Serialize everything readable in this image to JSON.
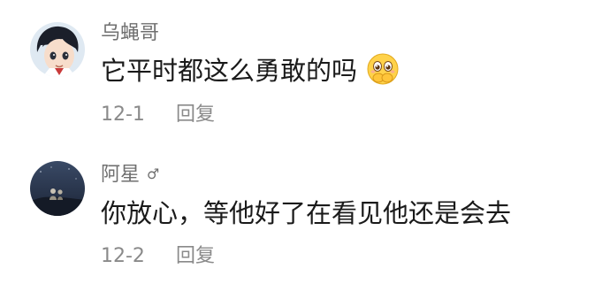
{
  "comments": [
    {
      "username": "乌蝇哥",
      "gender_mark": "",
      "text": "它平时都这么勇敢的吗",
      "emoji": "pleading-face-emoji",
      "date": "12-1",
      "reply_label": "回复"
    },
    {
      "username": "阿星",
      "gender_mark": "♂",
      "text": "你放心，等他好了在看见他还是会去",
      "emoji": "",
      "date": "12-2",
      "reply_label": "回复"
    }
  ],
  "colors": {
    "username": "#6f6f6f",
    "content": "#1a1a1a",
    "meta": "#8a8a8a",
    "background": "#ffffff"
  }
}
